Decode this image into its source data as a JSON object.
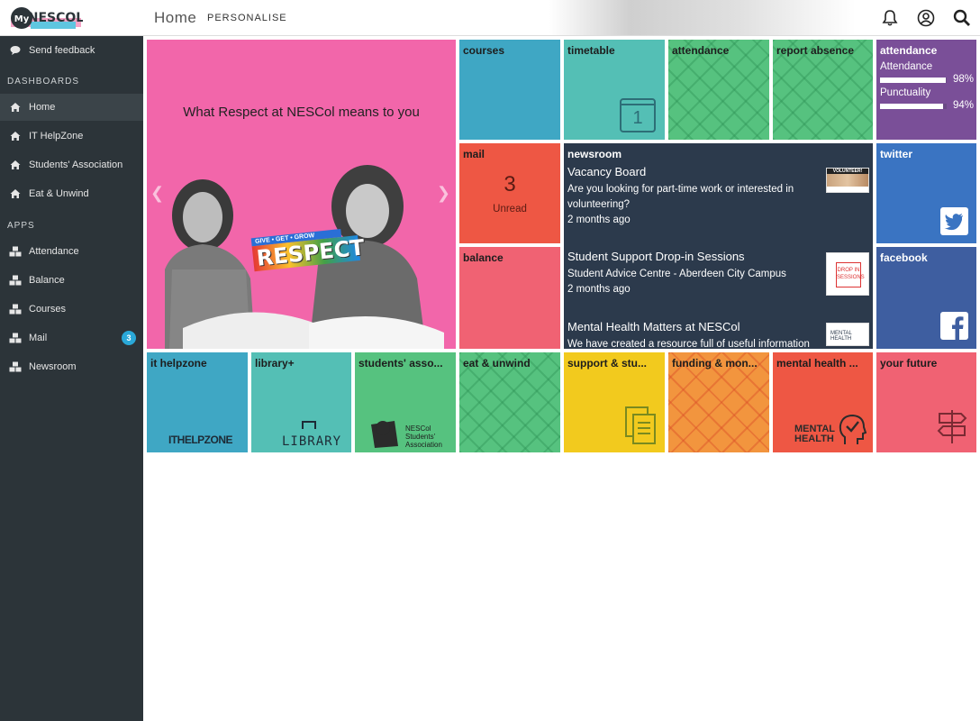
{
  "header": {
    "logo_text": "My NESCol",
    "title": "Home",
    "personalise": "PERSONALISE",
    "icons": [
      "bell-icon",
      "user-icon",
      "search-icon"
    ]
  },
  "sidebar": {
    "feedback": "Send feedback",
    "dashboards_heading": "DASHBOARDS",
    "dashboards": [
      {
        "label": "Home",
        "icon": "home-icon"
      },
      {
        "label": "IT HelpZone",
        "icon": "home-icon"
      },
      {
        "label": "Students' Association",
        "icon": "home-icon"
      },
      {
        "label": "Eat & Unwind",
        "icon": "home-icon"
      }
    ],
    "apps_heading": "APPS",
    "apps": [
      {
        "label": "Attendance",
        "icon": "cubes-icon"
      },
      {
        "label": "Balance",
        "icon": "cubes-icon"
      },
      {
        "label": "Courses",
        "icon": "cubes-icon"
      },
      {
        "label": "Mail",
        "icon": "cubes-icon",
        "badge": "3"
      },
      {
        "label": "Newsroom",
        "icon": "cubes-icon"
      }
    ]
  },
  "hero": {
    "title": "What Respect at NESCol means to you",
    "banner_small": "GIVE • GET • GROW",
    "banner_big": "RESPECT"
  },
  "tiles": {
    "courses": "courses",
    "timetable": "timetable",
    "timetable_day": "1",
    "attendance": "attendance",
    "report_absence": "report absence",
    "attendance_widget": "attendance",
    "mail": "mail",
    "mail_count": "3",
    "mail_unread": "Unread",
    "balance": "balance",
    "newsroom": "newsroom",
    "twitter": "twitter",
    "facebook": "facebook",
    "it_helpzone": "it helpzone",
    "it_helpzone_logo": "ITHELPZONE",
    "library": "library+",
    "library_logo": "LIBRARY",
    "students_assoc": "students' asso...",
    "students_assoc_logo_1": "NESCol",
    "students_assoc_logo_2": "Students'",
    "students_assoc_logo_3": "Association",
    "eat_unwind": "eat & unwind",
    "support": "support & stu...",
    "funding": "funding & mon...",
    "mental_health": "mental health ...",
    "mental_health_logo_1": "MENTAL",
    "mental_health_logo_2": "HEALTH",
    "your_future": "your future"
  },
  "attendance_stats": [
    {
      "label": "Attendance",
      "value": "98%",
      "fraction": 0.98
    },
    {
      "label": "Punctuality",
      "value": "94%",
      "fraction": 0.94
    }
  ],
  "news": [
    {
      "title": "Vacancy Board",
      "subtitle": "Are you looking for part-time work or interested in volunteering?",
      "age": "2 months ago",
      "thumb": "VOLUNTEER!"
    },
    {
      "title": "Student Support Drop-in Sessions",
      "subtitle": "Student Advice Centre - Aberdeen City Campus",
      "age": "2 months ago",
      "thumb": "DROP IN SESSIONS"
    },
    {
      "title": "Mental Health Matters at NESCol",
      "subtitle": "We have created a resource full of useful information",
      "age": "",
      "thumb": "MENTAL HEALTH"
    }
  ],
  "colors": {
    "sidebar_bg": "#2c3439",
    "hero_pink": "#f266aa",
    "teal_blue": "#3fa7c4",
    "teal": "#54bfb5",
    "green": "#56c27f",
    "purple": "#7a4f98",
    "red": "#ee5744",
    "pink_red": "#f06273",
    "navy": "#2c3a4c",
    "twitter_blue": "#3a74c2",
    "facebook_blue": "#3e5ea0",
    "yellow": "#f2ca1e",
    "orange": "#f2953e"
  }
}
